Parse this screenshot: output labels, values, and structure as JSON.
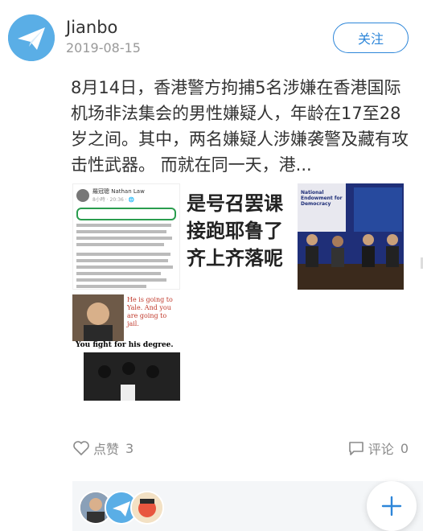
{
  "user": {
    "name": "Jianbo",
    "date": "2019-08-15"
  },
  "follow_label": "关注",
  "post_text": "8月14日，香港警方拘捕5名涉嫌在香港国际机场非法集会的男性嫌疑人，年龄在17至28岁之间。其中，两名嫌疑人涉嫌袭警及藏有攻击性武器。 而就在同一天，港...",
  "images": {
    "img1": {
      "name": "羅冠聰 Nathan Law",
      "sub": "8小時 · 20:36 · 🌐"
    },
    "img2": {
      "text": "是号召罢课\n接跑耶鲁了\n齐上齐落呢"
    },
    "img3": {
      "banner": "National Endowment for Democracy"
    },
    "img4": {
      "caption_right": "He is going to Yale. And you are going to jail.",
      "caption_bottom": "You fight for his degree."
    }
  },
  "likes": {
    "label": "点赞",
    "count": "3"
  },
  "comments": {
    "label": "评论",
    "count": "0"
  },
  "colors": {
    "accent": "#2d86d9",
    "muted": "#8a8a8a"
  }
}
